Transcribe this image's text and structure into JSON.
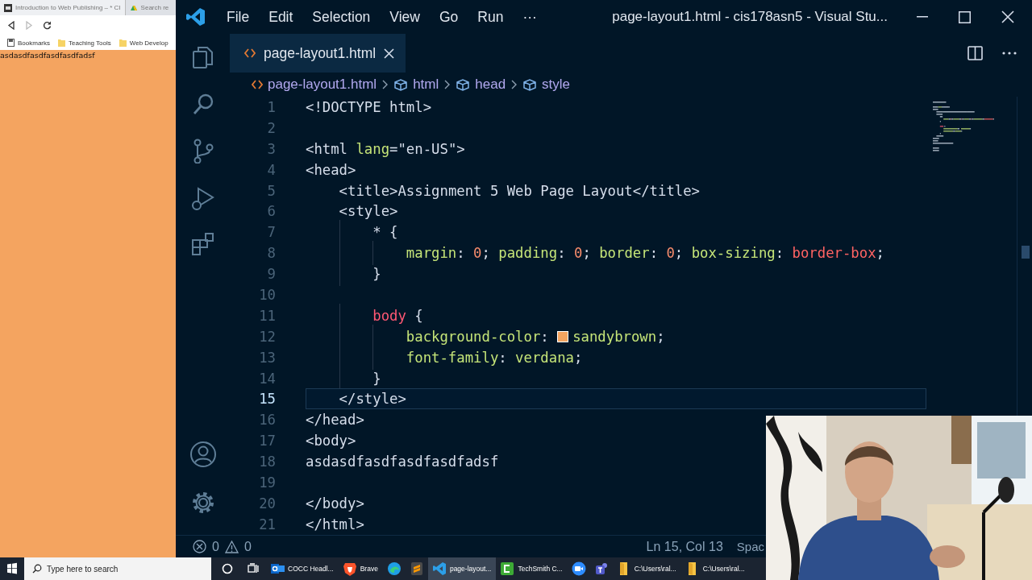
{
  "browser": {
    "tabs": [
      {
        "label": "Introduction to Web Publishing – * CI",
        "selected": true
      },
      {
        "label": "Search re",
        "selected": false
      }
    ],
    "bookmarks": [
      "Bookmarks",
      "Teaching Tools",
      "Web Develop"
    ],
    "page_text": "asdasdfasdfasdfasdfadsf"
  },
  "editor": {
    "menu": [
      "File",
      "Edit",
      "Selection",
      "View",
      "Go",
      "Run",
      "···"
    ],
    "title": "page-layout1.html - cis178asn5 - Visual Stu...",
    "tabs": [
      {
        "label": "page-layout1.html",
        "selected": true
      }
    ],
    "breadcrumb": [
      "page-layout1.html",
      "html",
      "head",
      "style"
    ],
    "lines": [
      {
        "number": "1",
        "current": false,
        "tokens": [
          {
            "t": "<!DOCTYPE html>",
            "kind": "tag"
          }
        ]
      },
      {
        "number": "2",
        "current": false
      },
      {
        "number": "3",
        "current": false,
        "tokens": [
          {
            "t": "<html ",
            "kind": "tag"
          },
          {
            "t": "lang",
            "kind": "attr"
          },
          {
            "t": "=",
            "kind": "tag"
          },
          {
            "t": "\"en-US\"",
            "kind": "str"
          },
          {
            "t": ">",
            "kind": "tag"
          }
        ]
      },
      {
        "number": "4",
        "current": false,
        "tokens": [
          {
            "t": "<head>",
            "kind": "tag"
          }
        ]
      },
      {
        "number": "5",
        "current": false,
        "tokens": [
          {
            "t": "    <title>",
            "kind": "tag"
          },
          {
            "t": "Assignment 5 Web Page Layout",
            "kind": "text"
          },
          {
            "t": "</title>",
            "kind": "tag"
          }
        ]
      },
      {
        "number": "6",
        "current": false,
        "tokens": [
          {
            "t": "    <style>",
            "kind": "tag"
          }
        ]
      },
      {
        "number": "7",
        "current": false,
        "tokens": [
          {
            "t": "        * {",
            "kind": "text"
          }
        ]
      },
      {
        "number": "8",
        "current": false,
        "tokens": [
          {
            "t": "            margin",
            "kind": "prop"
          },
          {
            "t": ": ",
            "kind": "punct"
          },
          {
            "t": "0",
            "kind": "num"
          },
          {
            "t": "; ",
            "kind": "punct"
          },
          {
            "t": "padding",
            "kind": "prop"
          },
          {
            "t": ": ",
            "kind": "punct"
          },
          {
            "t": "0",
            "kind": "num"
          },
          {
            "t": "; ",
            "kind": "punct"
          },
          {
            "t": "border",
            "kind": "prop"
          },
          {
            "t": ": ",
            "kind": "punct"
          },
          {
            "t": "0",
            "kind": "num"
          },
          {
            "t": "; ",
            "kind": "punct"
          },
          {
            "t": "box-sizing",
            "kind": "prop"
          },
          {
            "t": ": ",
            "kind": "punct"
          },
          {
            "t": "border-box",
            "kind": "keyword"
          },
          {
            "t": ";",
            "kind": "punct"
          }
        ]
      },
      {
        "number": "9",
        "current": false,
        "tokens": [
          {
            "t": "        }",
            "kind": "text"
          }
        ]
      },
      {
        "number": "10",
        "current": false
      },
      {
        "number": "11",
        "current": false,
        "tokens": [
          {
            "t": "        body",
            "kind": "selector"
          },
          {
            "t": " {",
            "kind": "punct"
          }
        ]
      },
      {
        "number": "12",
        "current": false,
        "tokens": [
          {
            "t": "            background-color",
            "kind": "prop"
          },
          {
            "t": ": ",
            "kind": "punct"
          },
          {
            "kind": "swatch",
            "color": "#f4a460"
          },
          {
            "t": "sandybrown",
            "kind": "value"
          },
          {
            "t": ";",
            "kind": "punct"
          }
        ]
      },
      {
        "number": "13",
        "current": false,
        "tokens": [
          {
            "t": "            font-family",
            "kind": "prop"
          },
          {
            "t": ": ",
            "kind": "punct"
          },
          {
            "t": "verdana",
            "kind": "value"
          },
          {
            "t": ";",
            "kind": "punct"
          }
        ]
      },
      {
        "number": "14",
        "current": false,
        "tokens": [
          {
            "t": "        }",
            "kind": "text"
          }
        ]
      },
      {
        "number": "15",
        "current": true,
        "tokens": [
          {
            "t": "    </style>",
            "kind": "tag"
          }
        ]
      },
      {
        "number": "16",
        "current": false,
        "tokens": [
          {
            "t": "</head>",
            "kind": "tag"
          }
        ]
      },
      {
        "number": "17",
        "current": false,
        "tokens": [
          {
            "t": "<body>",
            "kind": "tag"
          }
        ]
      },
      {
        "number": "18",
        "current": false,
        "tokens": [
          {
            "t": "asdasdfasdfasdfasdfadsf",
            "kind": "text"
          }
        ]
      },
      {
        "number": "19",
        "current": false
      },
      {
        "number": "20",
        "current": false,
        "tokens": [
          {
            "t": "</body>",
            "kind": "tag"
          }
        ]
      },
      {
        "number": "21",
        "current": false,
        "tokens": [
          {
            "t": "</html>",
            "kind": "tag"
          }
        ]
      }
    ],
    "status": {
      "errors": "0",
      "warnings": "0",
      "position": "Ln 15, Col 13",
      "indentation": "Spac"
    }
  },
  "taskbar": {
    "search": {
      "placeholder": "Type here to search"
    },
    "apps": [
      {
        "label": "COCC Headl...",
        "selected": false
      },
      {
        "label": "Brave",
        "selected": false
      },
      {
        "selected": false
      },
      {
        "selected": false
      },
      {
        "label": "page-layout...",
        "selected": true
      },
      {
        "label": "TechSmith C...",
        "selected": false
      },
      {
        "selected": false
      },
      {
        "selected": false
      },
      {
        "label": "C:\\Users\\ral...",
        "selected": false
      },
      {
        "label": "C:\\Users\\ral...",
        "selected": false
      }
    ]
  }
}
